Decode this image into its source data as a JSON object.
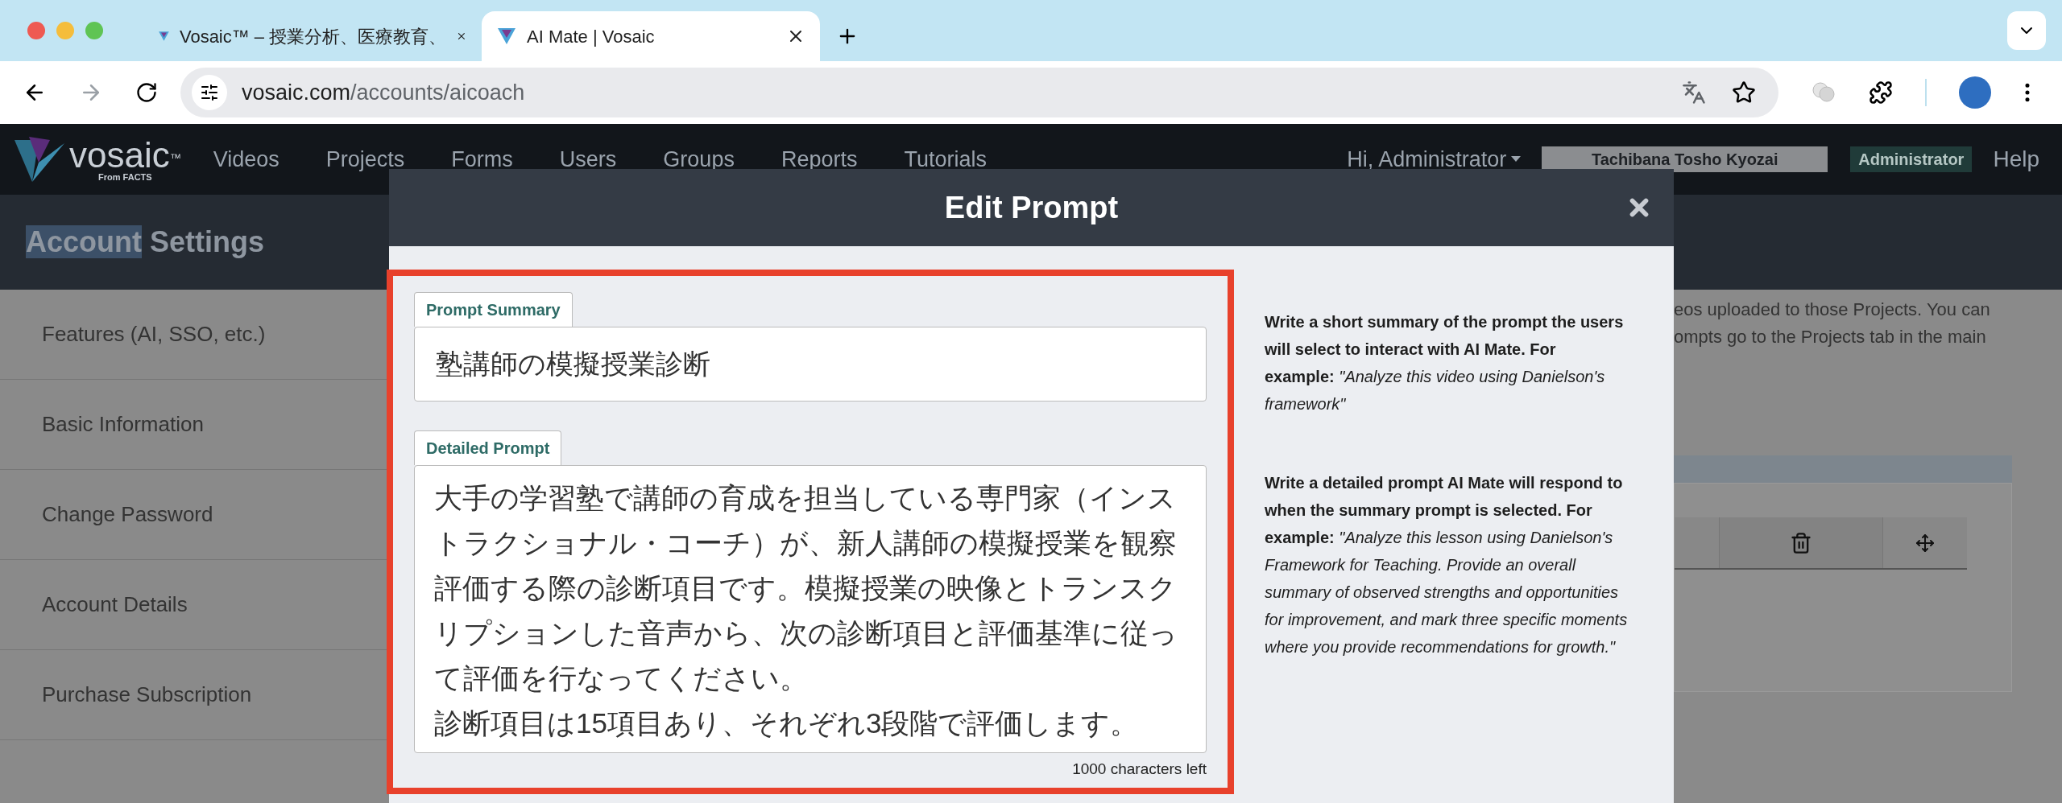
{
  "browser": {
    "tabs": [
      {
        "title": "Vosaic™ – 授業分析、医療教育、",
        "selected": false
      },
      {
        "title": "AI Mate | Vosaic",
        "selected": true
      }
    ],
    "url_host": "vosaic.com",
    "url_path": "/accounts/aicoach"
  },
  "nav": {
    "brand": "vosaic",
    "brand_mark": "™",
    "brand_sub": "From FACTS",
    "items": [
      "Videos",
      "Projects",
      "Forms",
      "Users",
      "Groups",
      "Reports",
      "Tutorials"
    ],
    "greeting": "Hi, Administrator",
    "account": "Tachibana Tosho Kyozai",
    "role": "Administrator",
    "help": "Help"
  },
  "page": {
    "title_highlight": "Account",
    "title_rest": "Settings",
    "sidebar": [
      "Features (AI, SSO, etc.)",
      "Basic Information",
      "Change Password",
      "Account Details",
      "Purchase Subscription"
    ],
    "intro_lines": [
      "eos uploaded to those Projects. You can",
      "ompts go to the Projects tab in the main"
    ]
  },
  "modal": {
    "title": "Edit Prompt",
    "summary": {
      "label": "Prompt Summary",
      "value": "塾講師の模擬授業診断"
    },
    "detailed": {
      "label": "Detailed Prompt",
      "paragraphs": [
        "大手の学習塾で講師の育成を担当している専門家（インストラクショナル・コーチ）が、新人講師の模擬授業を観察評価する際の診断項目です。模擬授業の映像とトランスクリプションした音声から、次の診断項目と評価基準に従って評価を行なってください。",
        "診断項目は15項目あり、それぞれ3段階で評価します。"
      ]
    },
    "counter": "1000 characters left",
    "help": [
      "**Write a short summary of the prompt the users will select to interact with AI Mate. For example:** *\"Analyze this video using Danielson's framework\"*",
      "**Write a detailed prompt AI Mate will respond to when the summary prompt is selected. For example:** *\"Analyze this lesson using Danielson's Framework for Teaching. Provide an overall summary of observed strengths and opportunities for improvement, and mark three specific moments where you provide recommendations for growth.\"*"
    ]
  }
}
